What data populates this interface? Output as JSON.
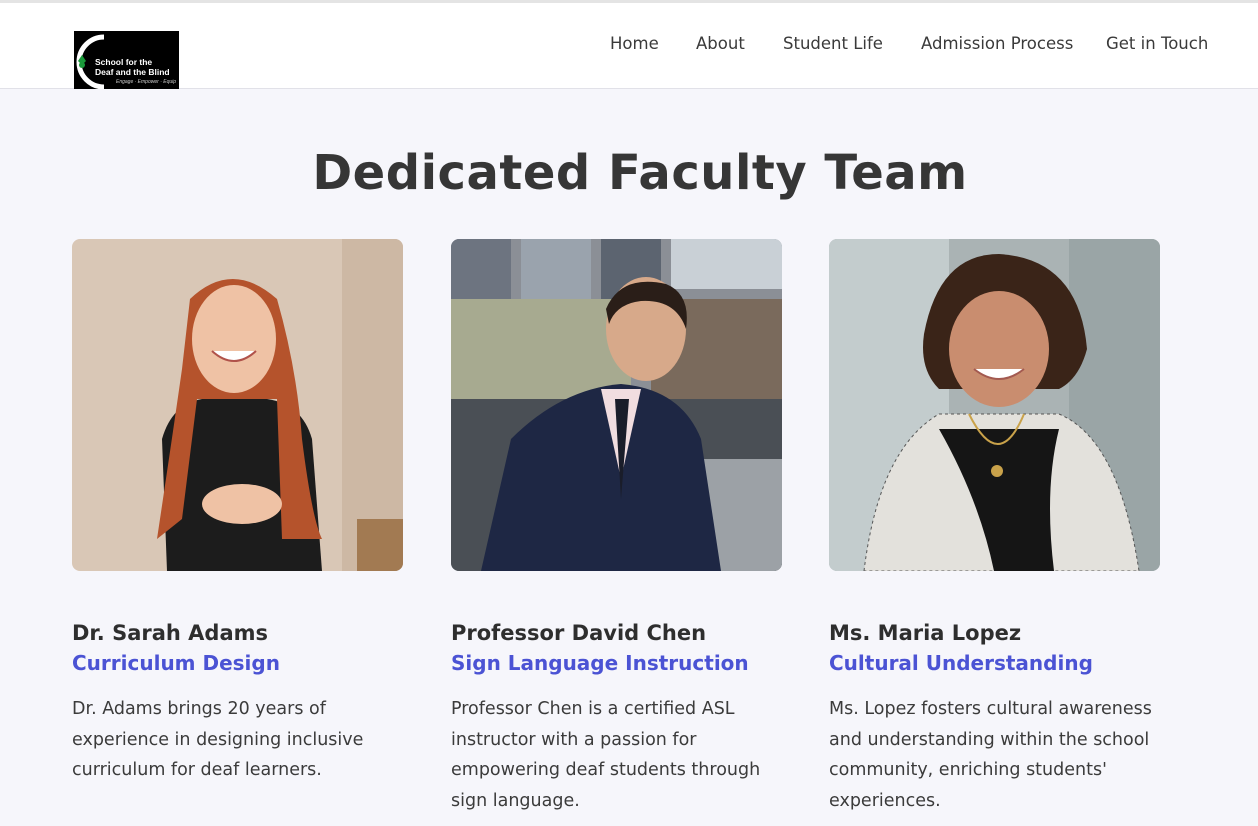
{
  "header": {
    "logo": {
      "line1": "School for the",
      "line2": "Deaf and the Blind",
      "tagline": "Engage · Empower · Equip"
    },
    "nav": [
      {
        "label": "Home"
      },
      {
        "label": "About"
      },
      {
        "label": "Student Life"
      },
      {
        "label": "Admission Process"
      },
      {
        "label": "Get in Touch"
      }
    ]
  },
  "main": {
    "title": "Dedicated Faculty Team",
    "faculty": [
      {
        "name": "Dr. Sarah Adams",
        "role": "Curriculum Design",
        "bio": "Dr. Adams brings 20 years of experience in designing inclusive curriculum for deaf learners."
      },
      {
        "name": "Professor David Chen",
        "role": "Sign Language Instruction",
        "bio": "Professor Chen is a certified ASL instructor with a passion for empowering deaf students through sign language."
      },
      {
        "name": "Ms. Maria Lopez",
        "role": "Cultural Understanding",
        "bio": "Ms. Lopez fosters cultural awareness and understanding within the school community, enriching students' experiences."
      }
    ]
  },
  "colors": {
    "accent": "#4b53d4",
    "heading": "#363636",
    "background": "#f6f6fb"
  }
}
